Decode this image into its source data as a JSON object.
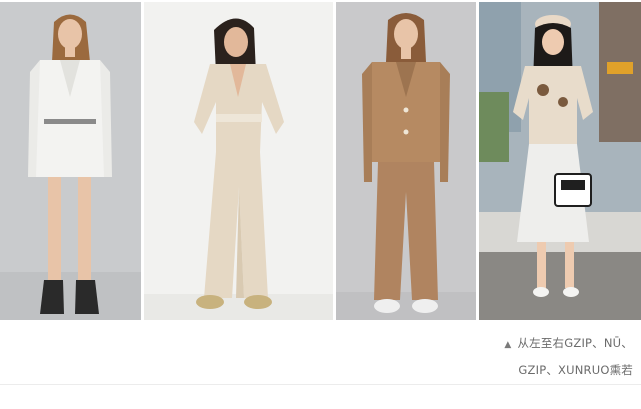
{
  "photos": [
    {
      "name": "white-blazer-dress-look",
      "colors": {
        "bg": "#c9cbcd",
        "outfit": "#f3f3f1",
        "hair": "#9b6a3e",
        "skin": "#e8c4a8",
        "boots": "#2a2a2a"
      }
    },
    {
      "name": "beige-jumpsuit-look",
      "colors": {
        "bg": "#f2f2f0",
        "outfit": "#e5d8c4",
        "hair": "#2b221d",
        "skin": "#e2b89a",
        "shoes": "#c8b27e"
      }
    },
    {
      "name": "camel-suit-look",
      "colors": {
        "bg": "#c9c9cb",
        "outfit": "#b68a62",
        "hair": "#8a5c3a",
        "skin": "#e8c4a8",
        "shoes": "#efefef"
      }
    },
    {
      "name": "street-style-look",
      "colors": {
        "bg": "#a8b4bc",
        "top": "#e8dccb",
        "skirt": "#eeeeec",
        "hat": "#e9d9c7",
        "hair": "#1d1a18",
        "bag": "#ffffff"
      }
    }
  ],
  "caption": {
    "marker": "▲",
    "line1": "从左至右GZIP、NŪ、",
    "line2": "GZIP、XUNRUO熏若"
  }
}
